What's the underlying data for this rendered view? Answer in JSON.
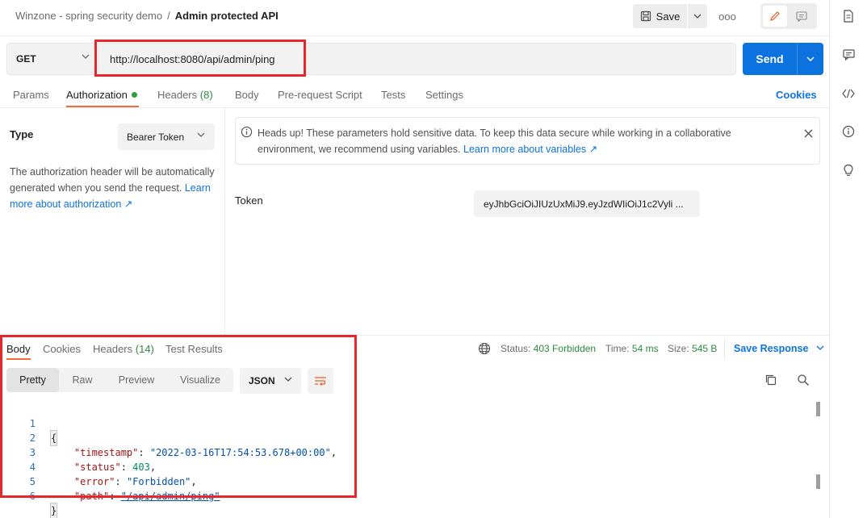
{
  "header": {
    "collection": "Winzone - spring security demo",
    "separator": "/",
    "request_name": "Admin protected API",
    "save_label": "Save",
    "more_label": "ooo"
  },
  "request": {
    "method": "GET",
    "url": "http://localhost:8080/api/admin/ping",
    "send_label": "Send"
  },
  "tabs": [
    {
      "label": "Params"
    },
    {
      "label": "Authorization"
    },
    {
      "label": "Headers",
      "count": "(8)"
    },
    {
      "label": "Body"
    },
    {
      "label": "Pre-request Script"
    },
    {
      "label": "Tests"
    },
    {
      "label": "Settings"
    }
  ],
  "cookies_label": "Cookies",
  "auth": {
    "type_label": "Type",
    "type_value": "Bearer Token",
    "description": "The authorization header will be automatically generated when you send the request.",
    "learn_more": "Learn more about authorization ↗",
    "notice": "Heads up! These parameters hold sensitive data. To keep this data secure while working in a collaborative environment, we recommend using variables.",
    "notice_link": "Learn more about variables ↗",
    "token_label": "Token",
    "token_value": "eyJhbGciOiJIUzUxMiJ9.eyJzdWIiOiJ1c2Vyli ..."
  },
  "response": {
    "tabs": [
      {
        "label": "Body"
      },
      {
        "label": "Cookies"
      },
      {
        "label": "Headers",
        "count": "(14)"
      },
      {
        "label": "Test Results"
      }
    ],
    "status_label": "Status:",
    "status_value": "403 Forbidden",
    "time_label": "Time:",
    "time_value": "54 ms",
    "size_label": "Size:",
    "size_value": "545 B",
    "save_response": "Save Response",
    "views": [
      "Pretty",
      "Raw",
      "Preview",
      "Visualize"
    ],
    "format": "JSON",
    "body_lines": {
      "l1": "{",
      "k2": "\"timestamp\"",
      "v2": "\"2022-03-16T17:54:53.678+00:00\"",
      "k3": "\"status\"",
      "v3": "403",
      "k4": "\"error\"",
      "v4": "\"Forbidden\"",
      "k5": "\"path\"",
      "v5": "\"/api/admin/ping\"",
      "l6": "}"
    },
    "line_numbers": [
      "1",
      "2",
      "3",
      "4",
      "5",
      "6"
    ]
  },
  "colors": {
    "accent": "#0c72dd",
    "tab_underline": "#f26b3a",
    "success": "#2e8a3f",
    "highlight_box": "#e8262c"
  }
}
